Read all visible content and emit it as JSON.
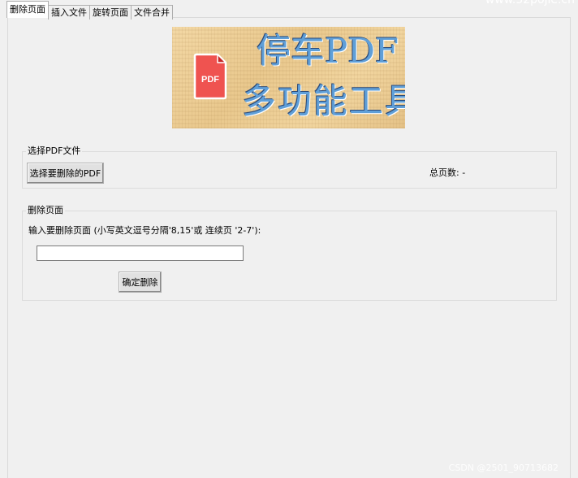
{
  "tabs": [
    {
      "label": "删除页面",
      "active": true
    },
    {
      "label": "插入文件",
      "active": false
    },
    {
      "label": "旋转页面",
      "active": false
    },
    {
      "label": "文件合并",
      "active": false
    }
  ],
  "banner": {
    "line1": "停车PDF",
    "line2": "多功能工具",
    "icon_text": "PDF",
    "icon": "pdf-file-icon",
    "colors": {
      "text": "#5f9fd8",
      "icon_red": "#ef5350",
      "background": "#eccb91"
    }
  },
  "select_group": {
    "title": "选择PDF文件",
    "button_label": "选择要删除的PDF",
    "page_count_label": "总页数: -"
  },
  "delete_group": {
    "title": "删除页面",
    "instruction": "输入要删除页面 (小写英文逗号分隔'8,15'或 连续页 '2-7'):",
    "input_value": "",
    "confirm_label": "确定删除"
  },
  "watermark": {
    "bottom": "CSDN @2501_90713682",
    "top": "www.52pojie.cn"
  }
}
